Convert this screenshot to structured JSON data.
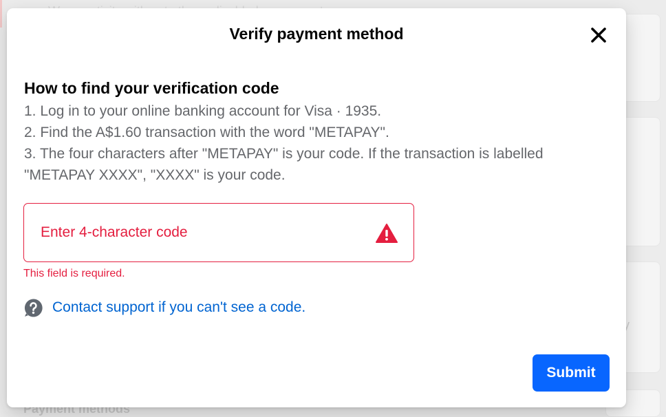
{
  "background": {
    "top_text": "We ... activity with ... to the ... disabled ... payment",
    "side_text": "y",
    "bottom_text": "Payment methods"
  },
  "modal": {
    "title": "Verify payment method",
    "close_icon": "close-icon",
    "section_heading": "How to find your verification code",
    "steps": [
      "1. Log in to your online banking account for Visa · 1935.",
      "2. Find the A$1.60 transaction with the word \"METAPAY\".",
      "3. The four characters after \"METAPAY\" is your code. If the transaction is labelled \"METAPAY XXXX\", \"XXXX\" is your code."
    ],
    "code_input": {
      "placeholder": "Enter 4-character code",
      "value": "",
      "status_icon": "warning-icon"
    },
    "error_message": "This field is required.",
    "support": {
      "icon": "help-icon",
      "link_text": "Contact support if you can't see a code."
    },
    "submit_label": "Submit"
  },
  "colors": {
    "error": "#e41e3f",
    "link": "#0064d1",
    "primary_button": "#0866ff",
    "body_text": "#65676b",
    "heading_text": "#050505"
  }
}
